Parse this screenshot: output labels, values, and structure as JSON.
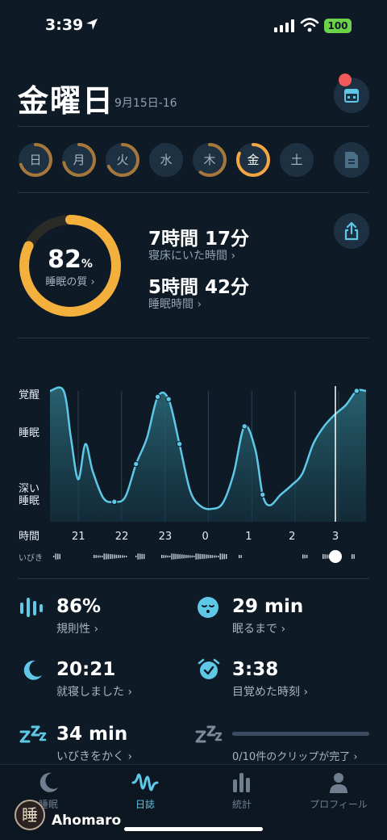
{
  "status_bar": {
    "time": "3:39",
    "battery": "100"
  },
  "header": {
    "title": "金曜日",
    "date_range": "9月15日-16"
  },
  "days": [
    {
      "label": "日",
      "progress": 0.7,
      "color": "#a6773a"
    },
    {
      "label": "月",
      "progress": 0.72,
      "color": "#a6773a"
    },
    {
      "label": "火",
      "progress": 0.68,
      "color": "#a6773a"
    },
    {
      "label": "水",
      "progress": 0.0,
      "color": "#a6773a"
    },
    {
      "label": "木",
      "progress": 0.6,
      "color": "#a6773a"
    },
    {
      "label": "金",
      "progress": 0.82,
      "color": "#f3a641",
      "selected": true
    },
    {
      "label": "土",
      "progress": 0.0,
      "color": "#a6773a"
    }
  ],
  "score": {
    "value": "82",
    "unit": "%",
    "label": "睡眠の質 ›",
    "fraction": 0.82
  },
  "stats": {
    "in_bed_value": "7時間 17分",
    "in_bed_label": "寝床にいた時間 ›",
    "asleep_value": "5時間 42分",
    "asleep_label": "睡眠時間 ›"
  },
  "chart": {
    "y_labels": {
      "awake": "覚醒",
      "sleep": "睡眠",
      "deep_1": "深い",
      "deep_2": "睡眠"
    },
    "x_axis_label": "時間",
    "x_ticks": [
      "21",
      "22",
      "23",
      "0",
      "1",
      "2",
      "3"
    ],
    "snore_label": "いびき"
  },
  "chart_data": {
    "type": "line",
    "x_label": "時間",
    "y_categories": [
      "深い睡眠",
      "睡眠",
      "覚醒"
    ],
    "x_ticks": [
      "21",
      "22",
      "23",
      "0",
      "1",
      "2",
      "3"
    ],
    "x": [
      "20:21",
      "20:40",
      "20:50",
      "21:00",
      "21:10",
      "21:20",
      "21:35",
      "21:50",
      "22:05",
      "22:20",
      "22:35",
      "22:50",
      "23:05",
      "23:20",
      "23:35",
      "23:50",
      "0:05",
      "0:20",
      "0:35",
      "0:50",
      "1:05",
      "1:15",
      "1:25",
      "1:40",
      "1:55",
      "2:10",
      "2:25",
      "2:40",
      "2:55",
      "3:10",
      "3:25",
      "3:38"
    ],
    "depth": [
      1.0,
      1.0,
      0.6,
      0.25,
      0.55,
      0.32,
      0.09,
      0.06,
      0.1,
      0.38,
      0.6,
      0.95,
      0.93,
      0.55,
      0.15,
      0.02,
      0.0,
      0.05,
      0.3,
      0.7,
      0.5,
      0.12,
      0.03,
      0.12,
      0.2,
      0.3,
      0.55,
      0.7,
      0.8,
      0.88,
      1.0,
      1.0
    ]
  },
  "metrics": {
    "regularity_value": "86%",
    "regularity_label": "規則性 ›",
    "fall_asleep_value": "29 min",
    "fall_asleep_label": "眠るまで ›",
    "bedtime_value": "20:21",
    "bedtime_label": "就寝しました ›",
    "wake_value": "3:38",
    "wake_label": "目覚めた時刻 ›",
    "snore_value": "34 min",
    "snore_label": "いびきをかく ›",
    "clips_label": "0/10件のクリップが完了 ›"
  },
  "tabbar": {
    "items": [
      {
        "label": "睡眠",
        "icon": "moon-icon"
      },
      {
        "label": "日誌",
        "icon": "wave-icon",
        "active": true
      },
      {
        "label": "統計",
        "icon": "bars-icon"
      },
      {
        "label": "プロフィール",
        "icon": "person-icon"
      }
    ]
  },
  "user": {
    "avatar_char": "睡",
    "name": "Ahomaro"
  },
  "colors": {
    "accent": "#5ec8e6",
    "score_ring": "#f3b03c",
    "background": "#0e1a26"
  }
}
